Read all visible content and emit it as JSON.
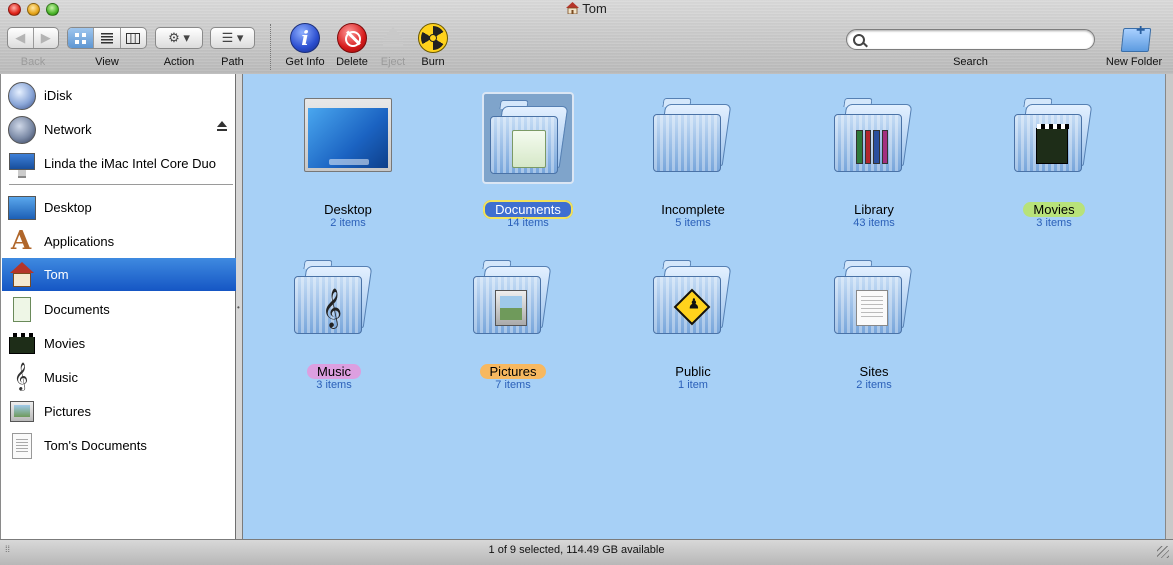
{
  "window": {
    "title": "Tom"
  },
  "toolbar": {
    "back_label": "Back",
    "view_label": "View",
    "action_label": "Action",
    "path_label": "Path",
    "get_info_label": "Get Info",
    "delete_label": "Delete",
    "eject_label": "Eject",
    "burn_label": "Burn",
    "search_label": "Search",
    "search_value": "",
    "new_folder_label": "New Folder"
  },
  "sidebar": {
    "items": [
      {
        "label": "iDisk",
        "icon": "globe-icon"
      },
      {
        "label": "Network",
        "icon": "network-globe-icon"
      },
      {
        "label": "Linda the iMac Intel Core Duo",
        "icon": "imac-icon"
      },
      {
        "label": "Desktop",
        "icon": "desktop-icon"
      },
      {
        "label": "Applications",
        "icon": "applications-icon"
      },
      {
        "label": "Tom",
        "icon": "home-icon",
        "selected": true
      },
      {
        "label": "Documents",
        "icon": "document-icon"
      },
      {
        "label": "Movies",
        "icon": "clapperboard-icon"
      },
      {
        "label": "Music",
        "icon": "treble-clef-icon"
      },
      {
        "label": "Pictures",
        "icon": "picture-frame-icon"
      },
      {
        "label": "Tom's Documents",
        "icon": "text-document-icon"
      }
    ]
  },
  "main": {
    "items": [
      {
        "name": "Desktop",
        "count": "2 items",
        "label_color": ""
      },
      {
        "name": "Documents",
        "count": "14 items",
        "label_color": "#3f6fd0",
        "selected": true
      },
      {
        "name": "Incomplete",
        "count": "5 items",
        "label_color": ""
      },
      {
        "name": "Library",
        "count": "43 items",
        "label_color": ""
      },
      {
        "name": "Movies",
        "count": "3 items",
        "label_color": "#b8e27a"
      },
      {
        "name": "Music",
        "count": "3 items",
        "label_color": "#dc9fe0"
      },
      {
        "name": "Pictures",
        "count": "7 items",
        "label_color": "#f7b860"
      },
      {
        "name": "Public",
        "count": "1 item",
        "label_color": ""
      },
      {
        "name": "Sites",
        "count": "2 items",
        "label_color": ""
      }
    ]
  },
  "status": {
    "text": "1 of 9 selected, 114.49 GB available"
  },
  "colors": {
    "selection": "#1c5fc8",
    "view_background": "#a7d0f6",
    "count_text": "#2a5fb8"
  }
}
